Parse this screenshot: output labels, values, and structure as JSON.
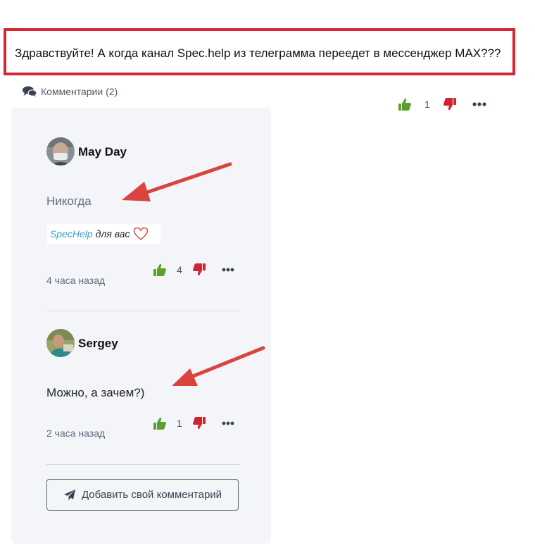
{
  "post": {
    "text": "Здравствуйте! А когда канал Spec.help из телеграмма переедет в мессенджер MAX???",
    "votes_count": "1"
  },
  "comments_section": {
    "header": "Комментарии (2)"
  },
  "comments": [
    {
      "author": "May Day",
      "text": "Никогда",
      "signature_brand": "SpecHelp",
      "signature_rest": "для вас",
      "time": "4 часа назад",
      "likes": "4"
    },
    {
      "author": "Sergey",
      "text": "Можно, а зачем?)",
      "time": "2 часа назад",
      "likes": "1"
    }
  ],
  "add_comment_button": "Добавить свой комментарий",
  "colors": {
    "highlight_border": "#d22a35",
    "like_green": "#5aa02c",
    "dislike_red": "#d0222f",
    "card_bg": "#f4f5f9",
    "muted_text": "#5f6b7c"
  },
  "icons": [
    "comments-icon",
    "thumbs-up-icon",
    "thumbs-down-icon",
    "more-icon",
    "paper-plane-icon",
    "heart-icon"
  ]
}
